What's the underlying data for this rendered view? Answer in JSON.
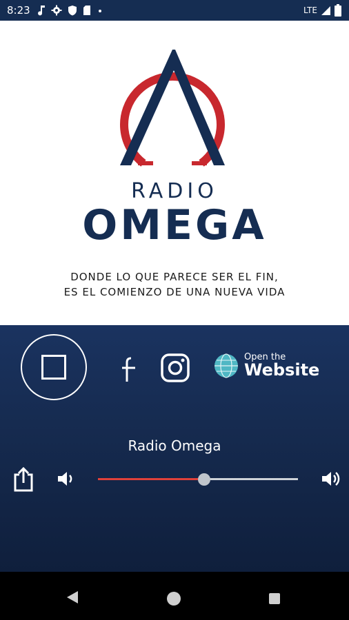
{
  "status_bar": {
    "time": "8:23",
    "network": "LTE",
    "icons": [
      "music-note-icon",
      "gear-icon",
      "shield-icon",
      "sd-card-icon",
      "dot-icon",
      "signal-icon",
      "battery-icon"
    ]
  },
  "logo": {
    "line1": "RADIO",
    "line2": "OMEGA",
    "colors": {
      "navy": "#152d52",
      "red": "#c8282e"
    }
  },
  "tagline": {
    "line1": "DONDE LO QUE PARECE SER EL FIN,",
    "line2": "ES EL COMIENZO DE UNA NUEVA VIDA"
  },
  "player": {
    "station_name": "Radio Omega",
    "website_small": "Open the",
    "website_large": "Website",
    "volume_fraction": 0.53,
    "colors": {
      "panel": "#1a3360",
      "slider_fill": "#e0413a",
      "slider_track": "#cfd3d8"
    }
  },
  "nav_bar": {
    "icons": [
      "back-icon",
      "home-icon",
      "recents-icon"
    ]
  }
}
